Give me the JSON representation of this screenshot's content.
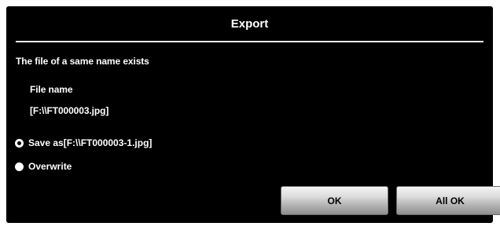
{
  "dialog": {
    "title": "Export",
    "message": "The file of a same name exists",
    "file_name_label": "File name",
    "file_name_value": "[F:\\\\FT000003.jpg]",
    "options": [
      {
        "label": "Save as[F:\\\\FT000003-1.jpg]",
        "selected": true
      },
      {
        "label": "Overwrite",
        "selected": false
      }
    ],
    "buttons": {
      "ok_label": "OK",
      "all_ok_label": "All OK"
    }
  },
  "colors": {
    "dialog_background": "#000000",
    "text": "#ffffff",
    "button_text": "#000000"
  }
}
